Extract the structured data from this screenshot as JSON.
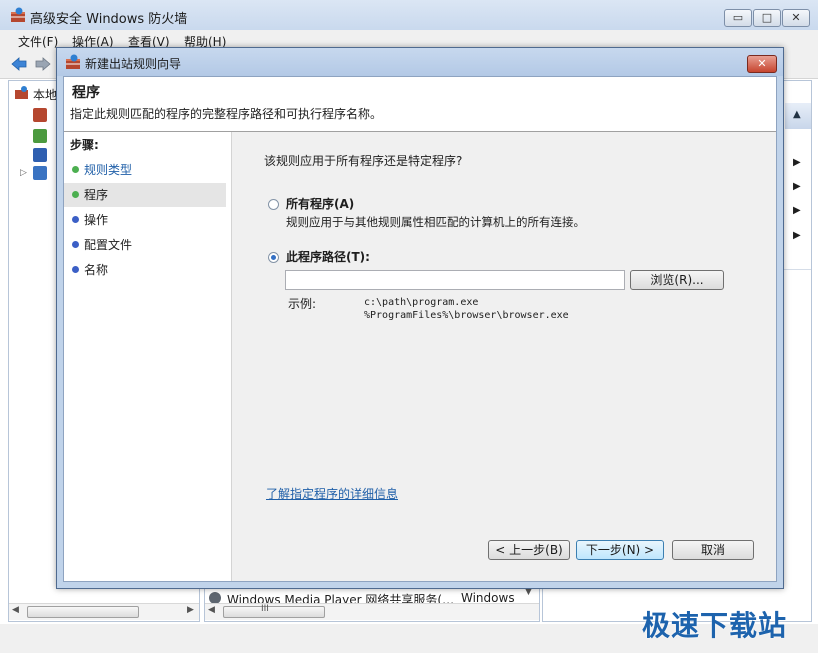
{
  "main_window": {
    "title": "高级安全 Windows 防火墙",
    "menu": [
      "文件(F)",
      "操作(A)",
      "查看(V)",
      "帮助(H)"
    ],
    "caption_buttons": {
      "minimize": "▭",
      "maximize": "□",
      "close": "✕"
    },
    "tree_root_label": "本地",
    "center_row_name": "Windows Media Player 网络共享服务(…",
    "center_row_group": "Windows",
    "scroll_label": "III",
    "icons": [
      "firewall-icon",
      "back-arrow-icon",
      "forward-arrow-icon",
      "computer-icon",
      "inbound-rules-icon",
      "outbound-rules-icon",
      "connection-security-icon",
      "monitoring-icon"
    ]
  },
  "dialog": {
    "title": "新建出站规则向导",
    "close_glyph": "✕",
    "header_title": "程序",
    "header_subtitle": "指定此规则匹配的程序的完整程序路径和可执行程序名称。",
    "steps_heading": "步骤:",
    "steps": [
      {
        "label": "规则类型",
        "state": "done",
        "dot_color": "#4caf50"
      },
      {
        "label": "程序",
        "state": "current",
        "dot_color": "#4caf50"
      },
      {
        "label": "操作",
        "state": "pending",
        "dot_color": "#3b5fc6"
      },
      {
        "label": "配置文件",
        "state": "pending",
        "dot_color": "#3b5fc6"
      },
      {
        "label": "名称",
        "state": "pending",
        "dot_color": "#3b5fc6"
      }
    ],
    "question": "该规则应用于所有程序还是特定程序?",
    "option_all_label": "所有程序(A)",
    "option_all_desc": "规则应用于与其他规则属性相匹配的计算机上的所有连接。",
    "option_path_label": "此程序路径(T):",
    "selected_option": "path",
    "path_value": "",
    "browse_label": "浏览(R)...",
    "example_label": "示例:",
    "example_line1": "c:\\path\\program.exe",
    "example_line2": "%ProgramFiles%\\browser\\browser.exe",
    "learn_more_link": "了解指定程序的详细信息",
    "back_label": "< 上一步(B)",
    "next_label": "下一步(N) >",
    "cancel_label": "取消"
  },
  "watermark": "极速下载站",
  "colors": {
    "link": "#1f5fa8",
    "accent": "#3470c4",
    "done_dot": "#4caf50",
    "pending_dot": "#3b5fc6"
  }
}
